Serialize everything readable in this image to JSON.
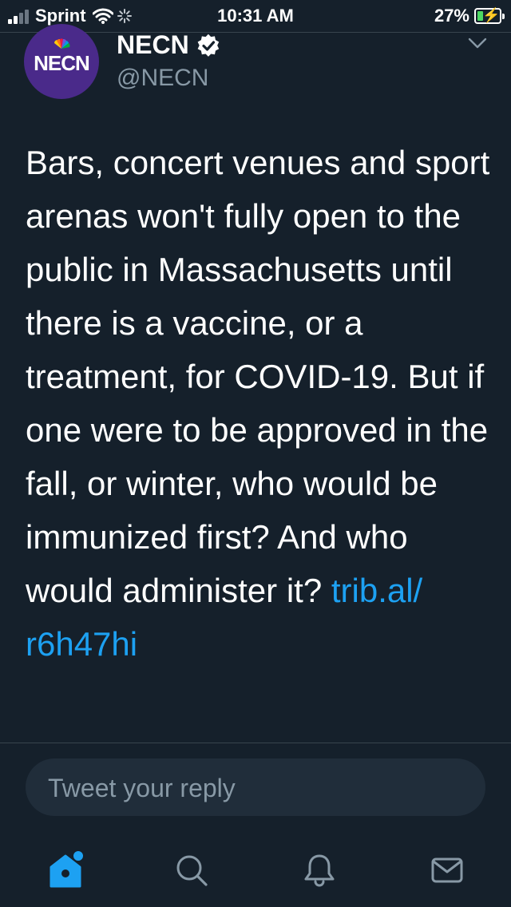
{
  "status_bar": {
    "carrier": "Sprint",
    "time": "10:31 AM",
    "battery_percent": "27%",
    "battery_level": 0.27,
    "signal_bars_filled": 2,
    "signal_bars_total": 4
  },
  "tweet": {
    "author_name": "NECN",
    "author_handle": "@NECN",
    "avatar_text": "NECN",
    "verified": true,
    "text": "Bars, concert venues and sport arenas won't fully open to the public in Massachusetts until there is a vaccine, or a treatment, for COVID-19. But if one were to be approved in the fall, or winter, who would be immunized first? And who would administer it? ",
    "link_text": "trib.al/\nr6h47hi"
  },
  "reply": {
    "placeholder": "Tweet your reply"
  },
  "tab_bar": {
    "items": [
      "home-icon",
      "search-icon",
      "notifications-icon",
      "messages-icon"
    ]
  },
  "colors": {
    "background": "#15202b",
    "accent": "#1da1f2",
    "secondary_text": "#8899a6",
    "avatar_bg": "#4a2a8a",
    "battery_fill": "#4cd964"
  }
}
